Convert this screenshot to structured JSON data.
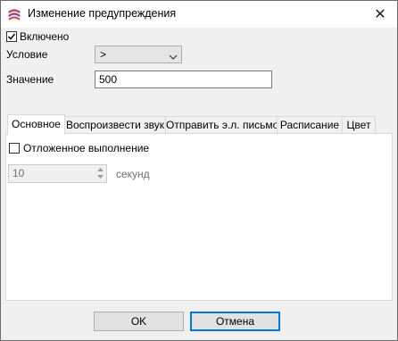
{
  "window": {
    "title": "Изменение предупреждения",
    "close_glyph": "✕"
  },
  "enabled": {
    "label": "Включено",
    "checked": true
  },
  "condition": {
    "label": "Условие",
    "value": ">"
  },
  "value_field": {
    "label": "Значение",
    "value": "500"
  },
  "tabs": [
    {
      "label": "Основное",
      "active": true
    },
    {
      "label": "Воспроизвести звук",
      "active": false
    },
    {
      "label": "Отправить э.л. письмо",
      "active": false
    },
    {
      "label": "Расписание",
      "active": false
    },
    {
      "label": "Цвет",
      "active": false
    }
  ],
  "general_tab": {
    "delayed_label": "Отложенное выполнение",
    "delayed_checked": false,
    "seconds_value": "10",
    "seconds_unit": "секунд"
  },
  "buttons": {
    "ok": "OK",
    "cancel": "Отмена"
  },
  "colors": {
    "accent": "#0078d7",
    "dialog_bg": "#f0f0f0"
  }
}
